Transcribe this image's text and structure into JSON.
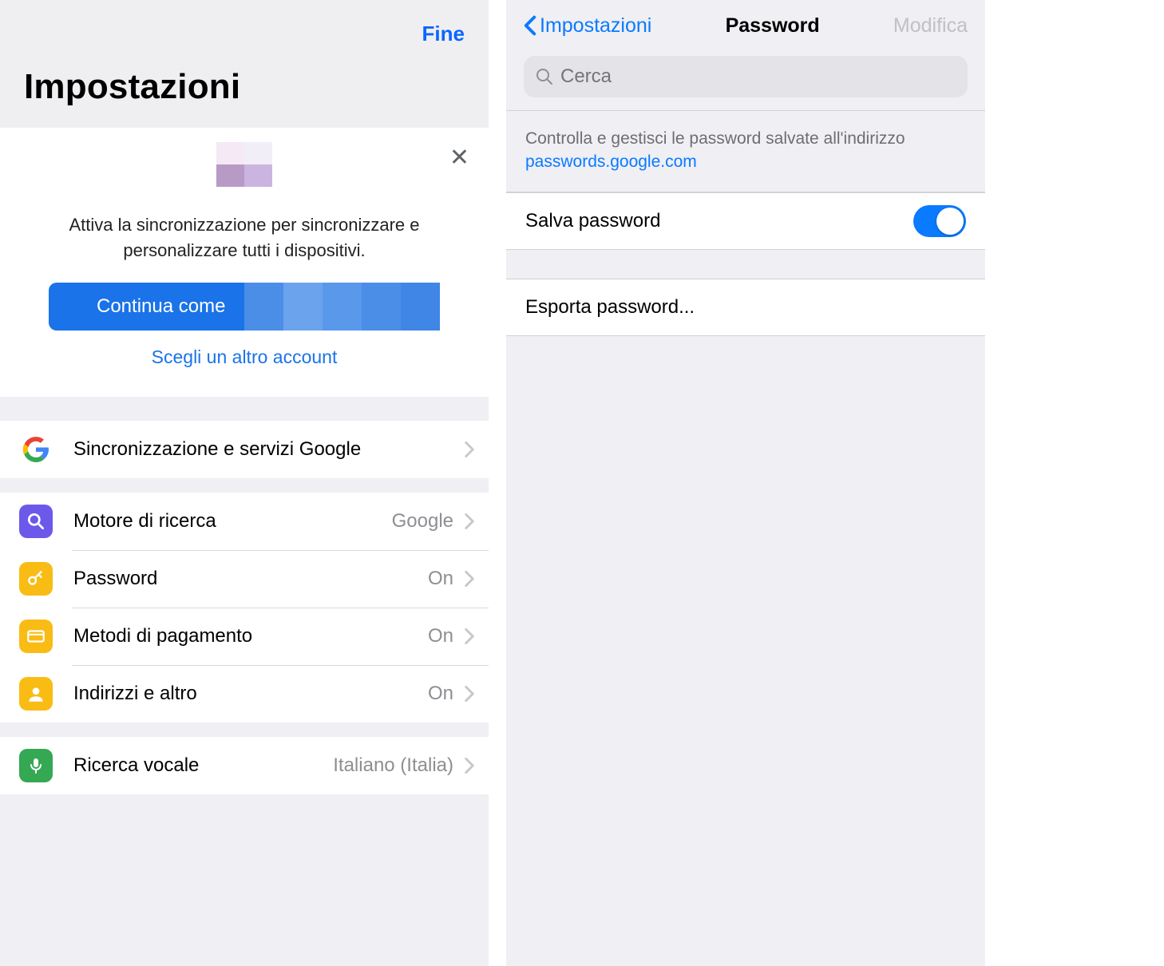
{
  "left": {
    "done": "Fine",
    "title": "Impostazioni",
    "sync": {
      "desc": "Attiva la sincronizzazione per sincronizzare e personalizzare tutti i dispositivi.",
      "continue": "Continua come",
      "choose": "Scegli un altro account"
    },
    "rows": {
      "sync_services": "Sincronizzazione e servizi Google",
      "search_engine": {
        "label": "Motore di ricerca",
        "value": "Google"
      },
      "password": {
        "label": "Password",
        "value": "On"
      },
      "payments": {
        "label": "Metodi di pagamento",
        "value": "On"
      },
      "addresses": {
        "label": "Indirizzi e altro",
        "value": "On"
      },
      "voice": {
        "label": "Ricerca vocale",
        "value": "Italiano (Italia)"
      }
    }
  },
  "right": {
    "back": "Impostazioni",
    "title": "Password",
    "edit": "Modifica",
    "search_placeholder": "Cerca",
    "info_text": "Controlla e gestisci le password salvate all'indirizzo",
    "info_link": "passwords.google.com",
    "save_password": "Salva password",
    "export": "Esporta password..."
  }
}
